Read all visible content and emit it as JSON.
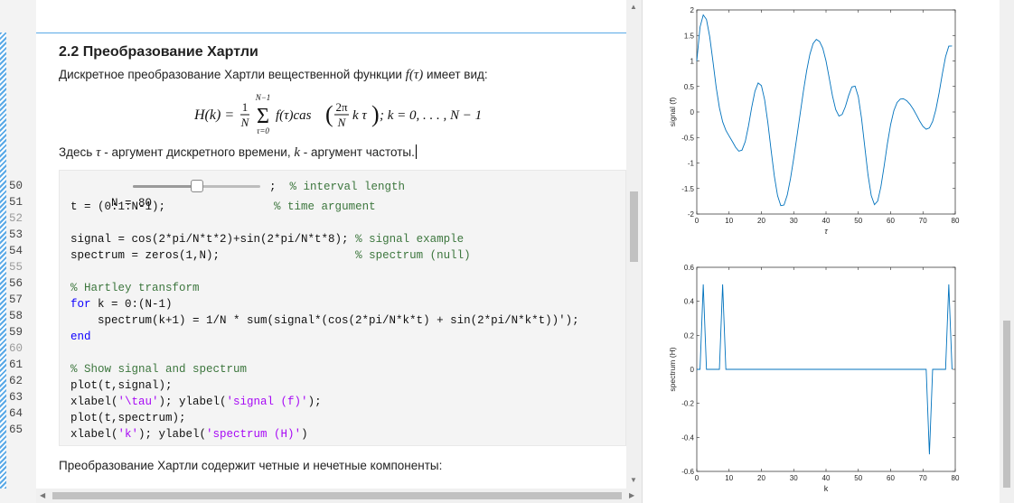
{
  "line_numbers": [
    "50",
    "51",
    "52",
    "53",
    "54",
    "55",
    "56",
    "57",
    "58",
    "59",
    "60",
    "61",
    "62",
    "63",
    "64",
    "65"
  ],
  "section": {
    "title": "2.2 Преобразование Хартли",
    "intro_before": "Дискретное преобразование Хартли вещественной функции ",
    "intro_func": "f(τ)",
    "intro_after": " имеет вид:",
    "formula": {
      "lhs": "H(k) = ",
      "frac_num": "1",
      "frac_den": "N",
      "sum_top": "N−1",
      "sum_bottom": "τ=0",
      "body": "f(τ)cas",
      "arg_num": "2π",
      "arg_den": "N",
      "arg_tail": "k τ",
      "tail": "; k = 0, . . . , N − 1"
    },
    "note_here": "Здесь ",
    "note_tau": "τ",
    "note_mid": " - аргумент дискретного времени, ",
    "note_k": "k",
    "note_end": " - аргумент частоты.",
    "closing": "Преобразование Хартли содержит четные и нечетные компоненты:"
  },
  "code": {
    "lines": [
      {
        "parts": [
          {
            "t": "N = ",
            "c": ""
          },
          {
            "t": "80",
            "c": ""
          }
        ]
      },
      {
        "parts": [
          {
            "t": "t = (0:1:N-1);",
            "c": ""
          },
          {
            "t": "                % time argument",
            "c": "cm"
          }
        ]
      },
      {
        "parts": [
          {
            "t": "",
            "c": ""
          }
        ]
      },
      {
        "parts": [
          {
            "t": "signal = cos(2*pi/N*t*2)+sin(2*pi/N*t*8); ",
            "c": ""
          },
          {
            "t": "% signal example",
            "c": "cm"
          }
        ]
      },
      {
        "parts": [
          {
            "t": "spectrum = zeros(1,N);                    ",
            "c": ""
          },
          {
            "t": "% spectrum (null)",
            "c": "cm"
          }
        ]
      },
      {
        "parts": [
          {
            "t": "",
            "c": ""
          }
        ]
      },
      {
        "parts": [
          {
            "t": "% Hartley transform",
            "c": "cm"
          }
        ]
      },
      {
        "parts": [
          {
            "t": "for",
            "c": "kw"
          },
          {
            "t": " k = 0:(N-1)",
            "c": ""
          }
        ]
      },
      {
        "parts": [
          {
            "t": "    spectrum(k+1) = 1/N * sum(signal*(cos(2*pi/N*k*t) + sin(2*pi/N*k*t))');",
            "c": ""
          }
        ]
      },
      {
        "parts": [
          {
            "t": "end",
            "c": "kw"
          }
        ]
      },
      {
        "parts": [
          {
            "t": "",
            "c": ""
          }
        ]
      },
      {
        "parts": [
          {
            "t": "% Show signal and spectrum",
            "c": "cm"
          }
        ]
      },
      {
        "parts": [
          {
            "t": "plot(t,signal);",
            "c": ""
          }
        ]
      },
      {
        "parts": [
          {
            "t": "xlabel(",
            "c": ""
          },
          {
            "t": "'\\tau'",
            "c": "str"
          },
          {
            "t": "); ylabel(",
            "c": ""
          },
          {
            "t": "'signal (f)'",
            "c": "str"
          },
          {
            "t": ");",
            "c": ""
          }
        ]
      },
      {
        "parts": [
          {
            "t": "plot(t,spectrum);",
            "c": ""
          }
        ]
      },
      {
        "parts": [
          {
            "t": "xlabel(",
            "c": ""
          },
          {
            "t": "'k'",
            "c": "str"
          },
          {
            "t": "); ylabel(",
            "c": ""
          },
          {
            "t": "'spectrum (H)'",
            "c": "str"
          },
          {
            "t": ")",
            "c": ""
          }
        ]
      }
    ],
    "slider": {
      "value": 80,
      "min": 0,
      "max": 160,
      "suffix": ";",
      "comment": "% interval length"
    }
  },
  "chart_data": [
    {
      "type": "line",
      "xlabel": "τ",
      "ylabel": "signal (f)",
      "xlim": [
        0,
        80
      ],
      "ylim": [
        -2,
        2
      ],
      "xticks": [
        0,
        10,
        20,
        30,
        40,
        50,
        60,
        70,
        80
      ],
      "yticks": [
        -2,
        -1.5,
        -1,
        -0.5,
        0,
        0.5,
        1,
        1.5,
        2
      ],
      "formula": "cos(2*pi/80*t*2)+sin(2*pi/80*t*8)",
      "x_range": [
        0,
        79
      ],
      "color": "#0072bd",
      "values": [
        1,
        1.6625,
        1.9022,
        1.8135,
        1.4756,
        0.9921,
        0.4856,
        0.0845,
        -0.1913,
        -0.3592,
        -0.4706,
        -0.5774,
        -0.6899,
        -0.7684,
        -0.7471,
        -0.5803,
        -0.2746,
        0.0921,
        0.4048,
        0.569,
        0.5181,
        0.2398,
        -0.2121,
        -0.7473,
        -1.2565,
        -1.6405,
        -1.8356,
        -1.8232,
        -1.6293,
        -1.3069,
        -0.9105,
        -0.4784,
        -0.0332,
        0.4049,
        0.8051,
        1.1294,
        1.3416,
        1.4229,
        1.3808,
        1.2499,
        1.0,
        0.662,
        0.3142,
        0.0469,
        -0.0795,
        -0.0481,
        0.1058,
        0.3217,
        0.4908,
        0.5063,
        0.2998,
        -0.1279,
        -0.6853,
        -1.2343,
        -1.6407,
        -1.8172,
        -1.7442,
        -1.4617,
        -1.0532,
        -0.6193,
        -0.2451,
        0.0262,
        0.1861,
        0.2541,
        0.2581,
        0.2198,
        0.1503,
        0.0555,
        -0.0585,
        -0.18,
        -0.2832,
        -0.3376,
        -0.3122,
        -0.1856,
        0.047,
        0.3742,
        0.7469,
        1.0839,
        1.2909,
        1.2933
      ],
      "values_note": ""
    },
    {
      "type": "line",
      "xlabel": "k",
      "ylabel": "spectrum (H)",
      "xlim": [
        0,
        80
      ],
      "ylim": [
        -0.6,
        0.6
      ],
      "xticks": [
        0,
        10,
        20,
        30,
        40,
        50,
        60,
        70,
        80
      ],
      "yticks": [
        -0.6,
        -0.4,
        -0.2,
        0,
        0.2,
        0.4,
        0.6
      ],
      "x_range": [
        0,
        79
      ],
      "color": "#0072bd",
      "points": [
        [
          0,
          0
        ],
        [
          1,
          0
        ],
        [
          2,
          0.5
        ],
        [
          3,
          0
        ],
        [
          7,
          0
        ],
        [
          8,
          0.5
        ],
        [
          9,
          0
        ],
        [
          71,
          0
        ],
        [
          72,
          -0.5
        ],
        [
          73,
          0
        ],
        [
          77,
          0
        ],
        [
          78,
          0.5
        ],
        [
          79,
          0
        ]
      ]
    }
  ]
}
